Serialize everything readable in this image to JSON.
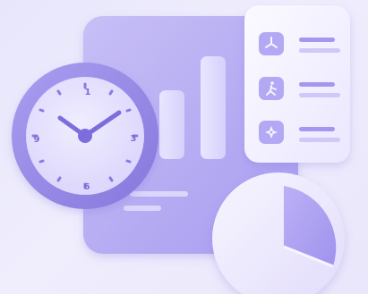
{
  "illustration": {
    "clock": {
      "numerals": [
        "1",
        "3",
        "6",
        "9"
      ],
      "icon": "analog-clock-icon"
    },
    "bar_chart": {
      "icon": "bar-chart-icon",
      "bar_levels": [
        0.35,
        0.55,
        0.82
      ]
    },
    "side_panel": {
      "items": [
        {
          "icon": "windmill-icon"
        },
        {
          "icon": "walker-icon"
        },
        {
          "icon": "shuriken-icon"
        }
      ]
    },
    "pie_chart": {
      "icon": "pie-chart-icon",
      "slices": [
        0.24,
        0.76
      ]
    },
    "colors": {
      "board": "#b7adf2",
      "accent": "#9b8bef",
      "panel": "#f4f1ff",
      "card": "#ece8ff"
    }
  }
}
